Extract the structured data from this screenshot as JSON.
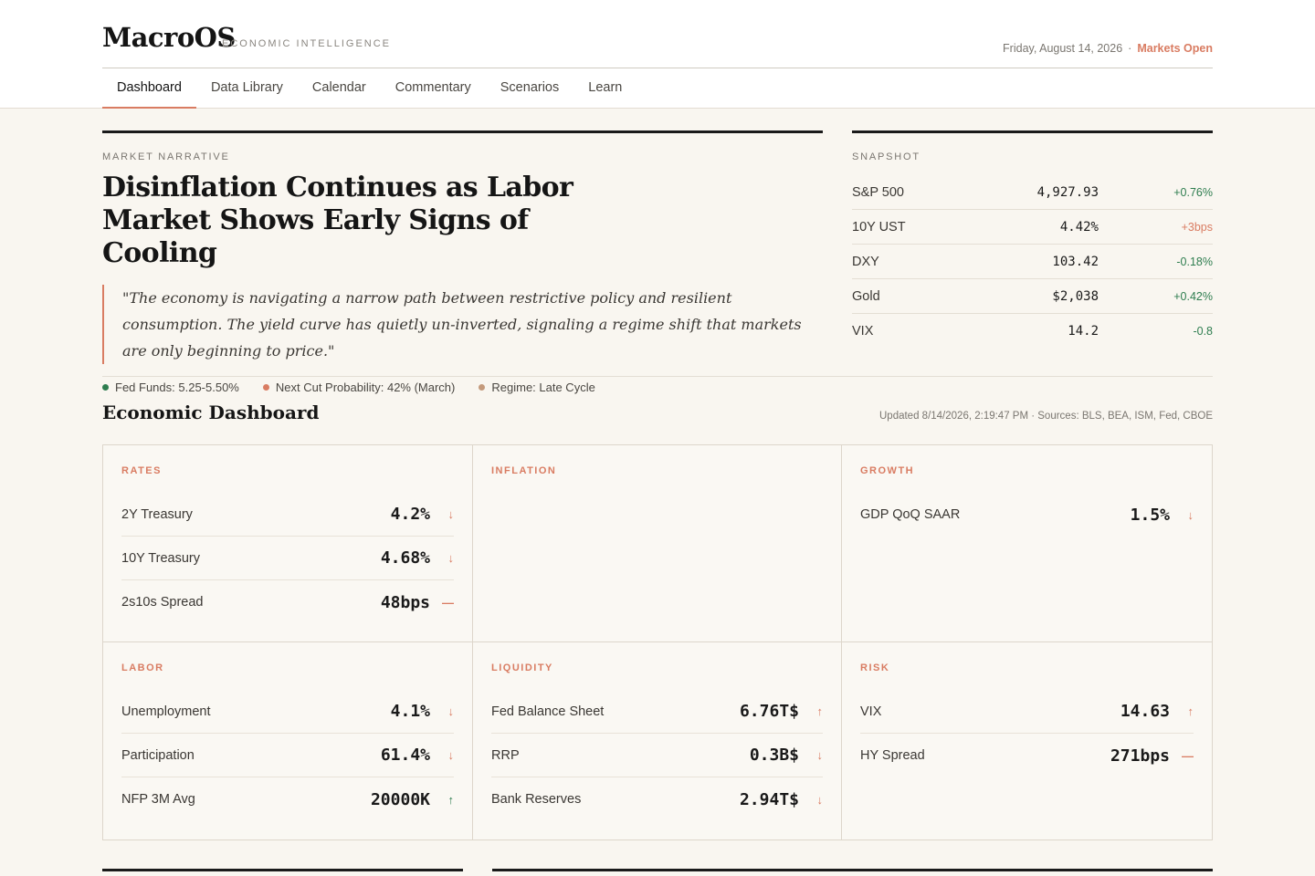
{
  "header": {
    "brand": "MacroOS",
    "tagline": "ECONOMIC INTELLIGENCE",
    "date": "Friday, August 14, 2026",
    "separator": "·",
    "market_status": "Markets Open"
  },
  "nav": {
    "items": [
      "Dashboard",
      "Data Library",
      "Calendar",
      "Commentary",
      "Scenarios",
      "Learn"
    ],
    "active": "Dashboard"
  },
  "narrative": {
    "kicker": "MARKET NARRATIVE",
    "headline": "Disinflation Continues as Labor Market Shows Early Signs of Cooling",
    "quote": "\"The economy is navigating a narrow path between restrictive policy and resilient consumption. The yield curve has quietly un-inverted, signaling a regime shift that markets are only beginning to price.\"",
    "chips": [
      {
        "label": "Fed Funds: 5.25-5.50%",
        "color": "#2e7d4f"
      },
      {
        "label": "Next Cut Probability: 42% (March)",
        "color": "#d97c62"
      },
      {
        "label": "Regime: Late Cycle",
        "color": "#c49a7c"
      }
    ]
  },
  "snapshot": {
    "kicker": "SNAPSHOT",
    "rows": [
      {
        "name": "S&P 500",
        "value": "4,927.93",
        "change": "+0.76%",
        "dir": "pos"
      },
      {
        "name": "10Y UST",
        "value": "4.42%",
        "change": "+3bps",
        "dir": "neg"
      },
      {
        "name": "DXY",
        "value": "103.42",
        "change": "-0.18%",
        "dir": "pos"
      },
      {
        "name": "Gold",
        "value": "$2,038",
        "change": "+0.42%",
        "dir": "pos"
      },
      {
        "name": "VIX",
        "value": "14.2",
        "change": "-0.8",
        "dir": "pos"
      }
    ]
  },
  "dashboard": {
    "title": "Economic Dashboard",
    "updated": "Updated 8/14/2026, 2:19:47 PM · Sources: BLS, BEA, ISM, Fed, CBOE",
    "sections": [
      {
        "title": "RATES",
        "metrics": [
          {
            "name": "2Y Treasury",
            "value": "4.2%",
            "arrow": "↓",
            "kind": "down"
          },
          {
            "name": "10Y Treasury",
            "value": "4.68%",
            "arrow": "↓",
            "kind": "down"
          },
          {
            "name": "2s10s Spread",
            "value": "48bps",
            "arrow": "—",
            "kind": "flat"
          }
        ]
      },
      {
        "title": "INFLATION",
        "metrics": []
      },
      {
        "title": "GROWTH",
        "metrics": [
          {
            "name": "GDP QoQ SAAR",
            "value": "1.5%",
            "arrow": "↓",
            "kind": "down"
          }
        ]
      },
      {
        "title": "LABOR",
        "metrics": [
          {
            "name": "Unemployment",
            "value": "4.1%",
            "arrow": "↓",
            "kind": "down"
          },
          {
            "name": "Participation",
            "value": "61.4%",
            "arrow": "↓",
            "kind": "down"
          },
          {
            "name": "NFP 3M Avg",
            "value": "20000K",
            "arrow": "↑",
            "kind": "up-pos"
          }
        ]
      },
      {
        "title": "LIQUIDITY",
        "metrics": [
          {
            "name": "Fed Balance Sheet",
            "value": "6.76T$",
            "arrow": "↑",
            "kind": "up-neg"
          },
          {
            "name": "RRP",
            "value": "0.3B$",
            "arrow": "↓",
            "kind": "down"
          },
          {
            "name": "Bank Reserves",
            "value": "2.94T$",
            "arrow": "↓",
            "kind": "down"
          }
        ]
      },
      {
        "title": "RISK",
        "metrics": [
          {
            "name": "VIX",
            "value": "14.63",
            "arrow": "↑",
            "kind": "up-neg"
          },
          {
            "name": "HY Spread",
            "value": "271bps",
            "arrow": "—",
            "kind": "flat"
          }
        ]
      }
    ]
  }
}
